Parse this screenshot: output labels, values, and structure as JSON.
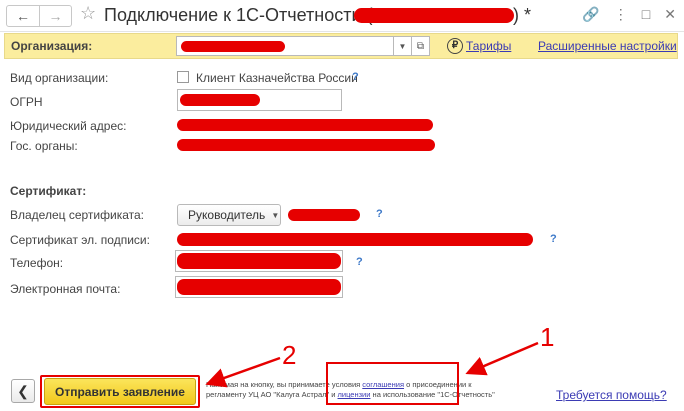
{
  "window": {
    "title_prefix": "Подключение к 1С-Отчетности (",
    "title_suffix": ") *",
    "back_icon": "arrow-left-icon",
    "forward_icon": "arrow-right-icon",
    "favorite_icon": "star-icon",
    "link_icon": "link-icon",
    "more_icon": "more-vertical-icon",
    "maximize_icon": "maximize-icon",
    "close_icon": "close-icon"
  },
  "org_bar": {
    "label": "Организация:",
    "tariffs_link": "Тарифы",
    "advanced_link": "Расширенные настройки",
    "ruble_symbol": "₽"
  },
  "fields": {
    "org_type_label": "Вид организации:",
    "treasury_client_label": "Клиент Казначейства России",
    "ogrn_label": "ОГРН",
    "legal_address_label": "Юридический адрес:",
    "gov_bodies_label": "Гос. органы:",
    "certificate_heading": "Сертификат:",
    "cert_owner_label": "Владелец сертификата:",
    "cert_owner_value": "Руководитель",
    "cert_signature_label": "Сертификат эл. подписи:",
    "phone_label": "Телефон:",
    "email_label": "Электронная почта:",
    "help_mark": "?"
  },
  "footer": {
    "back_icon": "chevron-left-icon",
    "send_button": "Отправить заявление",
    "notice_part1": "Нажимая на кнопку, вы принимаете условия",
    "notice_link1": "соглашения",
    "notice_part2": "о присоединении к регламенту УЦ АО \"Калуга Астрал\" и",
    "notice_link2": "лицензии",
    "notice_part3": "на использование \"1С-Отчетность\"",
    "help_link": "Требуется помощь?"
  },
  "annotations": {
    "callout_1": "1",
    "callout_2": "2"
  },
  "colors": {
    "redaction": "#e60000",
    "org_bar_bg": "#fbed9e",
    "send_button": "#f2c81b",
    "link": "#3b3bb4"
  }
}
